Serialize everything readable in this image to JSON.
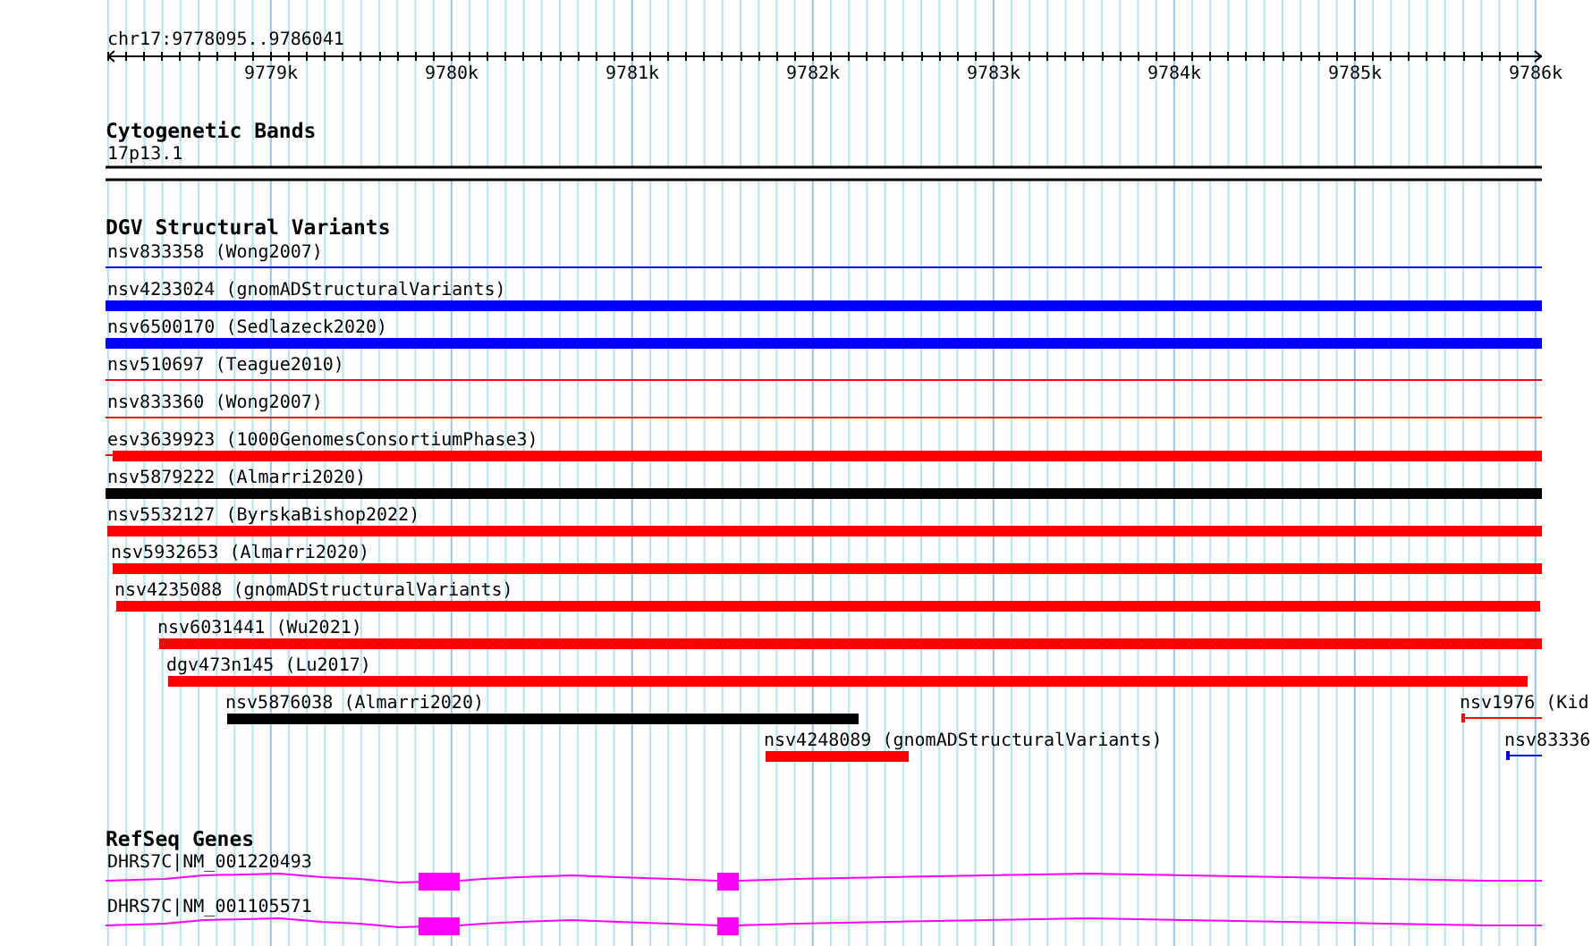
{
  "ruler": {
    "location": "chr17:9778095..9786041",
    "ticks": [
      "9779k",
      "9780k",
      "9781k",
      "9782k",
      "9783k",
      "9784k",
      "9785k",
      "9786k"
    ]
  },
  "tracks": [
    {
      "title": "Cytogenetic Bands",
      "features": [
        {
          "label": "17p13.1",
          "kind": "band",
          "color": "#000000"
        }
      ]
    },
    {
      "title": "DGV Structural Variants",
      "features": [
        {
          "label": "nsv833358 (Wong2007)",
          "kind": "line",
          "color": "#0000ff"
        },
        {
          "label": "nsv4233024 (gnomADStructuralVariants)",
          "kind": "bar",
          "color": "#0000ff"
        },
        {
          "label": "nsv6500170 (Sedlazeck2020)",
          "kind": "bar",
          "color": "#0000ff"
        },
        {
          "label": "nsv510697 (Teague2010)",
          "kind": "line",
          "color": "#ff0000"
        },
        {
          "label": "nsv833360 (Wong2007)",
          "kind": "line",
          "color": "#ff0000"
        },
        {
          "label": "esv3639923 (1000GenomesConsortiumPhase3)",
          "kind": "bar",
          "color": "#ff0000"
        },
        {
          "label": "nsv5879222 (Almarri2020)",
          "kind": "bar",
          "color": "#000000"
        },
        {
          "label": "nsv5532127 (ByrskaBishop2022)",
          "kind": "bar",
          "color": "#ff0000"
        },
        {
          "label": "nsv5932653 (Almarri2020)",
          "kind": "bar",
          "color": "#ff0000"
        },
        {
          "label": "nsv4235088 (gnomADStructuralVariants)",
          "kind": "bar",
          "color": "#ff0000"
        },
        {
          "label": "nsv6031441 (Wu2021)",
          "kind": "bar",
          "color": "#ff0000"
        },
        {
          "label": "dgv473n145 (Lu2017)",
          "kind": "bar",
          "color": "#ff0000"
        },
        {
          "label": "nsv5876038 (Almarri2020)",
          "kind": "bar",
          "color": "#000000"
        },
        {
          "label": "nsv1976 (Kid",
          "kind": "line",
          "color": "#ff0000"
        },
        {
          "label": "nsv4248089 (gnomADStructuralVariants)",
          "kind": "bar",
          "color": "#ff0000"
        },
        {
          "label": "nsv83336",
          "kind": "line",
          "color": "#0000ff"
        }
      ]
    },
    {
      "title": "RefSeq Genes",
      "features": [
        {
          "label": "DHRS7C|NM_001220493",
          "kind": "gene",
          "color": "#ff00ff"
        },
        {
          "label": "DHRS7C|NM_001105571",
          "kind": "gene",
          "color": "#ff00ff"
        }
      ]
    }
  ]
}
